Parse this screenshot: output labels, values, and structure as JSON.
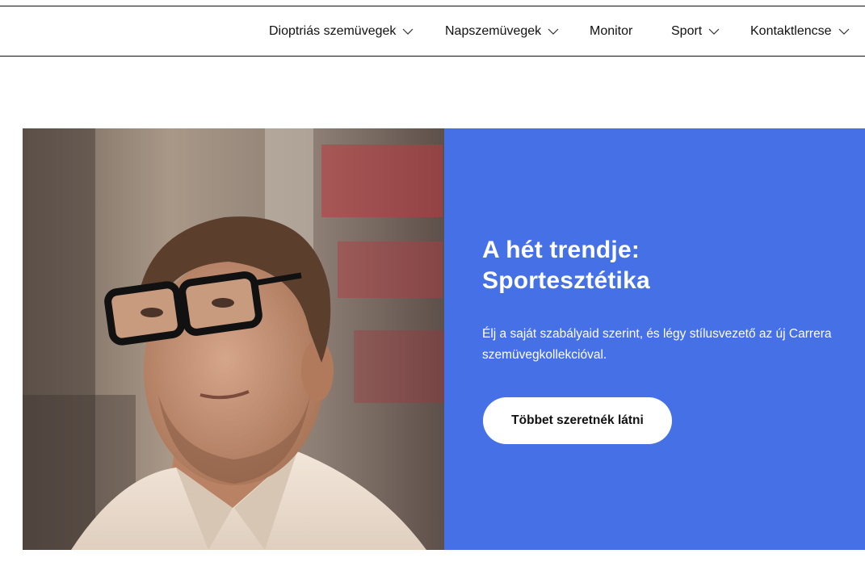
{
  "nav": {
    "items": [
      {
        "label": "Dioptriás szemüvegek",
        "has_dropdown": true,
        "icon": "chevron-down-icon"
      },
      {
        "label": "Napszemüvegek",
        "has_dropdown": true,
        "icon": "chevron-down-icon"
      },
      {
        "label": "Monitor",
        "has_dropdown": false
      },
      {
        "label": "Sport",
        "has_dropdown": true,
        "icon": "chevron-down-icon"
      },
      {
        "label": "Kontaktlencse",
        "has_dropdown": true,
        "icon": "chevron-down-icon"
      }
    ]
  },
  "hero": {
    "title_line1": "A hét trendje:",
    "title_line2": "Sportesztétika",
    "description": "Élj a saját szabályaid szerint, és légy stílusvezető az új Carrera szemüvegkollekcióval.",
    "cta_label": "Többet szeretnék látni",
    "panel_color": "#4570e6"
  }
}
